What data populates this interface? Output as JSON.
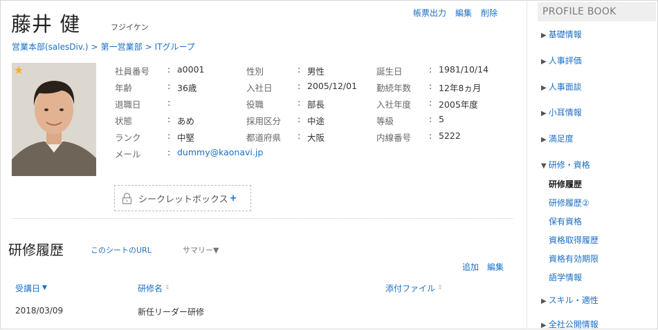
{
  "header": {
    "name": "藤井 健",
    "kana": "フジイケン",
    "actions": [
      "帳票出力",
      "編集",
      "削除"
    ]
  },
  "breadcrumb": [
    "営業本部(salesDiv.)",
    "第一営業部",
    "ITグループ"
  ],
  "profile": {
    "rows": [
      [
        {
          "label": "社員番号",
          "value": "a0001"
        },
        {
          "label": "性別",
          "value": "男性"
        },
        {
          "label": "誕生日",
          "value": "1981/10/14"
        }
      ],
      [
        {
          "label": "年齢",
          "value": "36歳"
        },
        {
          "label": "入社日",
          "value": "2005/12/01"
        },
        {
          "label": "勤続年数",
          "value": "12年8ヵ月"
        }
      ],
      [
        {
          "label": "退職日",
          "value": ""
        },
        {
          "label": "役職",
          "value": "部長"
        },
        {
          "label": "入社年度",
          "value": "2005年度"
        }
      ],
      [
        {
          "label": "状態",
          "value": "あめ"
        },
        {
          "label": "採用区分",
          "value": "中途"
        },
        {
          "label": "等級",
          "value": "5"
        }
      ],
      [
        {
          "label": "ランク",
          "value": "中堅"
        },
        {
          "label": "都道府県",
          "value": "大阪"
        },
        {
          "label": "内線番号",
          "value": "5222"
        }
      ]
    ],
    "email_label": "メール",
    "email": "dummy@kaonavi.jp",
    "secret_box": "シークレットボックス"
  },
  "section": {
    "title": "研修履歴",
    "url_link": "このシートのURL",
    "summary": "サマリー▼",
    "actions": [
      "追加",
      "編集"
    ],
    "columns": [
      "受講日",
      "研修名",
      "添付ファイル"
    ],
    "rows": [
      [
        "2018/03/09",
        "新任リーダー研修",
        ""
      ]
    ]
  },
  "sidebar": {
    "title": "PROFILE BOOK",
    "items": [
      {
        "label": "基礎情報"
      },
      {
        "label": "人事評価"
      },
      {
        "label": "人事面談"
      },
      {
        "label": "小耳情報"
      },
      {
        "label": "満足度"
      },
      {
        "label": "研修・資格"
      }
    ],
    "subitems": [
      {
        "label": "研修履歴"
      },
      {
        "label": "研修履歴②"
      },
      {
        "label": "保有資格"
      },
      {
        "label": "資格取得履歴"
      },
      {
        "label": "資格有効期限"
      },
      {
        "label": "語学情報"
      }
    ],
    "items_after": [
      {
        "label": "スキル・適性"
      },
      {
        "label": "全社公開情報"
      }
    ]
  }
}
